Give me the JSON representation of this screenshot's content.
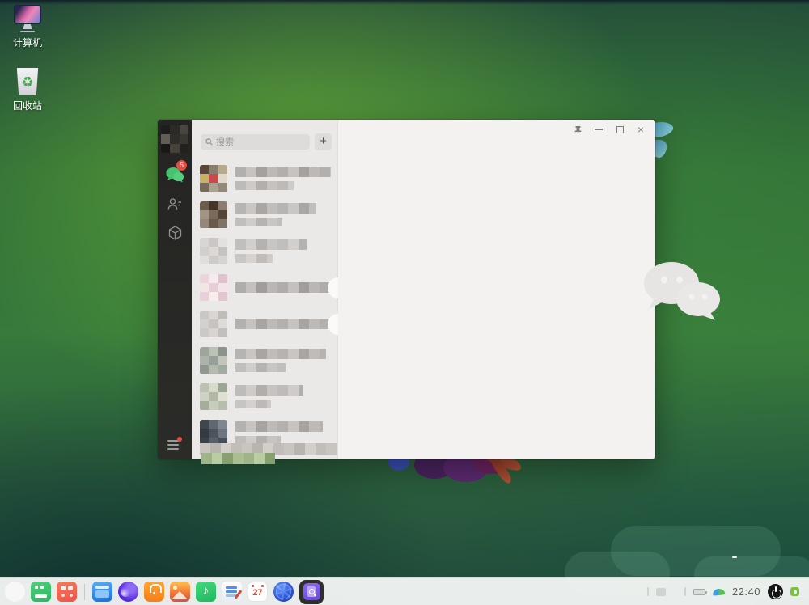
{
  "desktop": {
    "computer_label": "计算机",
    "recycle_label": "回收站"
  },
  "wechat": {
    "search_placeholder": "搜索",
    "add_label": "+",
    "chat_badge": "5"
  },
  "chat_rows": [
    {
      "avatar": [
        "#574639",
        "#897d6d",
        "#b7a98c",
        "#c6b166",
        "#c84a4a",
        "#e0d8c8",
        "#756a5c",
        "#aca290",
        "#93897a"
      ],
      "grays": [
        "#b3afac",
        "#c7c3c0",
        "#a5a19e",
        "#bdb9b6"
      ],
      "bars": [
        118,
        72
      ],
      "pill": false
    },
    {
      "avatar": [
        "#6d5b49",
        "#463528",
        "#8b7e70",
        "#a39583",
        "#7a6c5c",
        "#55443a",
        "#94887a",
        "#6a5a4b",
        "#807466"
      ],
      "grays": [
        "#b8b4b1",
        "#cac6c3",
        "#aaa6a3",
        "#c1bdba"
      ],
      "bars": [
        100,
        58
      ],
      "pill": false
    },
    {
      "avatar": [
        "#d8d5d2",
        "#c9c6c3",
        "#e3e0dd",
        "#d1cecb",
        "#dbd8d5",
        "#c5c2bf",
        "#e0ddda",
        "#cdcac7",
        "#d6d3d0"
      ],
      "grays": [
        "#c2bebb",
        "#d2cecb",
        "#b6b2af",
        "#c9c5c2"
      ],
      "bars": [
        88,
        46
      ],
      "pill": false
    },
    {
      "avatar": [
        "#ecd3dc",
        "#f5eaee",
        "#dfc2cd",
        "#f0e6e3",
        "#e6cdd6",
        "#f3e4e9",
        "#e9d0da",
        "#f6efe9",
        "#e2c6d1"
      ],
      "grays": [
        "#b0acaa",
        "#c4c0bd",
        "#a19d9a",
        "#bab6b3"
      ],
      "bars": [
        150,
        0
      ],
      "pill": true
    },
    {
      "avatar": [
        "#cbc7c4",
        "#dad6d3",
        "#c0bcb9",
        "#d4d0cd",
        "#c7c3c0",
        "#dedad7",
        "#ccc8c5",
        "#d8d4d1",
        "#c3bfbc"
      ],
      "grays": [
        "#b4b0ae",
        "#c6c2bf",
        "#a8a4a1",
        "#bdb9b6"
      ],
      "bars": [
        142,
        0
      ],
      "pill": true
    },
    {
      "avatar": [
        "#9da69c",
        "#bcc1b5",
        "#8a948c",
        "#aeb3a7",
        "#97a098",
        "#c2c6ba",
        "#8f9991",
        "#b5baae",
        "#a2aba1"
      ],
      "grays": [
        "#b7b3b0",
        "#c9c5c2",
        "#a9a5a2",
        "#c0bcb9"
      ],
      "bars": [
        112,
        62
      ],
      "pill": false
    },
    {
      "avatar": [
        "#bcc2b1",
        "#d8dacb",
        "#9ca695",
        "#cfd2c2",
        "#b1b8a6",
        "#dee0d2",
        "#a5ae9c",
        "#c8ccba",
        "#b8bead"
      ],
      "grays": [
        "#bfbbb8",
        "#cfcbc8",
        "#b2aeab",
        "#c7c3c0"
      ],
      "bars": [
        84,
        44
      ],
      "pill": false
    },
    {
      "avatar": [
        "#41464a",
        "#5f6870",
        "#7e878f",
        "#333a40",
        "#4b545c",
        "#6d767e",
        "#39424a",
        "#58616a",
        "#47505a"
      ],
      "grays": [
        "#b5b1ae",
        "#c8c4c1",
        "#a7a3a0",
        "#bebab7"
      ],
      "bars": [
        108,
        56
      ],
      "pill": false
    }
  ],
  "chat_bottom": {
    "gray_colors": [
      "#c8c5c0",
      "#b8b5b0",
      "#d2cfca",
      "#c1beb9"
    ],
    "gray_cells": 13,
    "green_colors": [
      "#9fb489",
      "#b9cda2",
      "#86a070",
      "#a9bf92"
    ],
    "green_cells": 7
  },
  "sidebar_avatar": [
    "#1d1d1b",
    "#2a2a26",
    "#4a463f",
    "#635e55",
    "#2e2d29",
    "#383732",
    "#191816",
    "#454139",
    "#23221e"
  ],
  "taskbar": {
    "clock": "22:40",
    "calendar_day": "27",
    "apps": [
      "launcher",
      "multitasking-view",
      "app-grid",
      "file-manager",
      "browser",
      "app-store",
      "image-viewer",
      "music-player",
      "text-editor",
      "calendar",
      "globe-app",
      "document-viewer-active"
    ]
  },
  "icons": {
    "music_note": "♪",
    "recycle_glyph": "♻",
    "close_glyph": "×"
  },
  "colors": {
    "wechat_green": "#44c26d",
    "badge_red": "#e84b42",
    "sidebar_dark": "#2b2b28",
    "list_bg": "#ebe9e7",
    "main_bg": "#f3f2f1",
    "accent_blue": "#1a6fe0"
  }
}
